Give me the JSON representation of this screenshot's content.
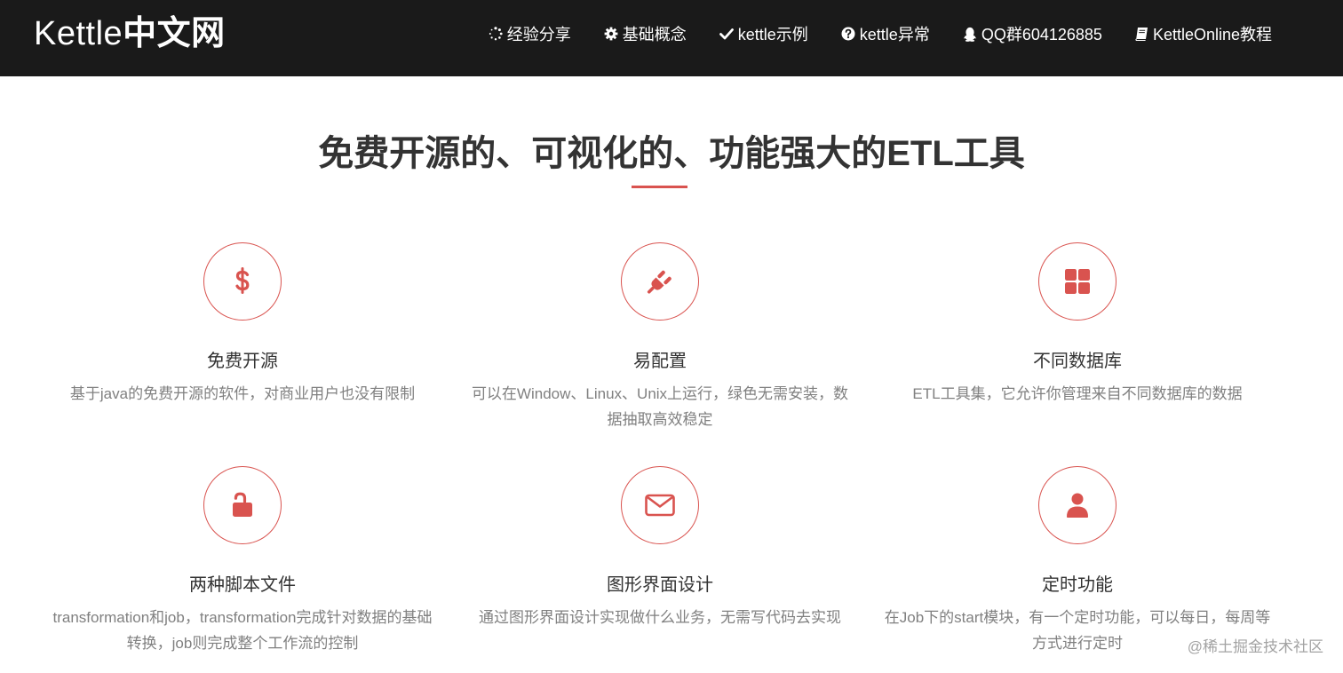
{
  "brand": {
    "latin": "Kettle",
    "cn": "中文网"
  },
  "nav": {
    "items": [
      {
        "label": "经验分享",
        "icon": "spinner-icon"
      },
      {
        "label": "基础概念",
        "icon": "gear-icon"
      },
      {
        "label": "kettle示例",
        "icon": "check-icon"
      },
      {
        "label": "kettle异常",
        "icon": "question-circle-icon"
      },
      {
        "label": "QQ群604126885",
        "icon": "qq-icon"
      },
      {
        "label": "KettleOnline教程",
        "icon": "book-icon"
      }
    ]
  },
  "headline": {
    "text": "免费开源的、可视化的、功能强大的ETL工具"
  },
  "features": [
    {
      "icon": "dollar-icon",
      "title": "免费开源",
      "desc": "基于java的免费开源的软件，对商业用户也没有限制"
    },
    {
      "icon": "plug-icon",
      "title": "易配置",
      "desc": "可以在Window、Linux、Unix上运行，绿色无需安装，数据抽取高效稳定"
    },
    {
      "icon": "grid-icon",
      "title": "不同数据库",
      "desc": "ETL工具集，它允许你管理来自不同数据库的数据"
    },
    {
      "icon": "unlock-icon",
      "title": "两种脚本文件",
      "desc": "transformation和job，transformation完成针对数据的基础转换，job则完成整个工作流的控制"
    },
    {
      "icon": "envelope-icon",
      "title": "图形界面设计",
      "desc": "通过图形界面设计实现做什么业务，无需写代码去实现"
    },
    {
      "icon": "user-icon",
      "title": "定时功能",
      "desc": "在Job下的start模块，有一个定时功能，可以每日，每周等方式进行定时"
    }
  ],
  "watermark": "@稀土掘金技术社区",
  "colors": {
    "navbar_bg": "#1a1a1a",
    "accent": "#d9534f",
    "heading": "#333333",
    "body_text": "#808080"
  }
}
